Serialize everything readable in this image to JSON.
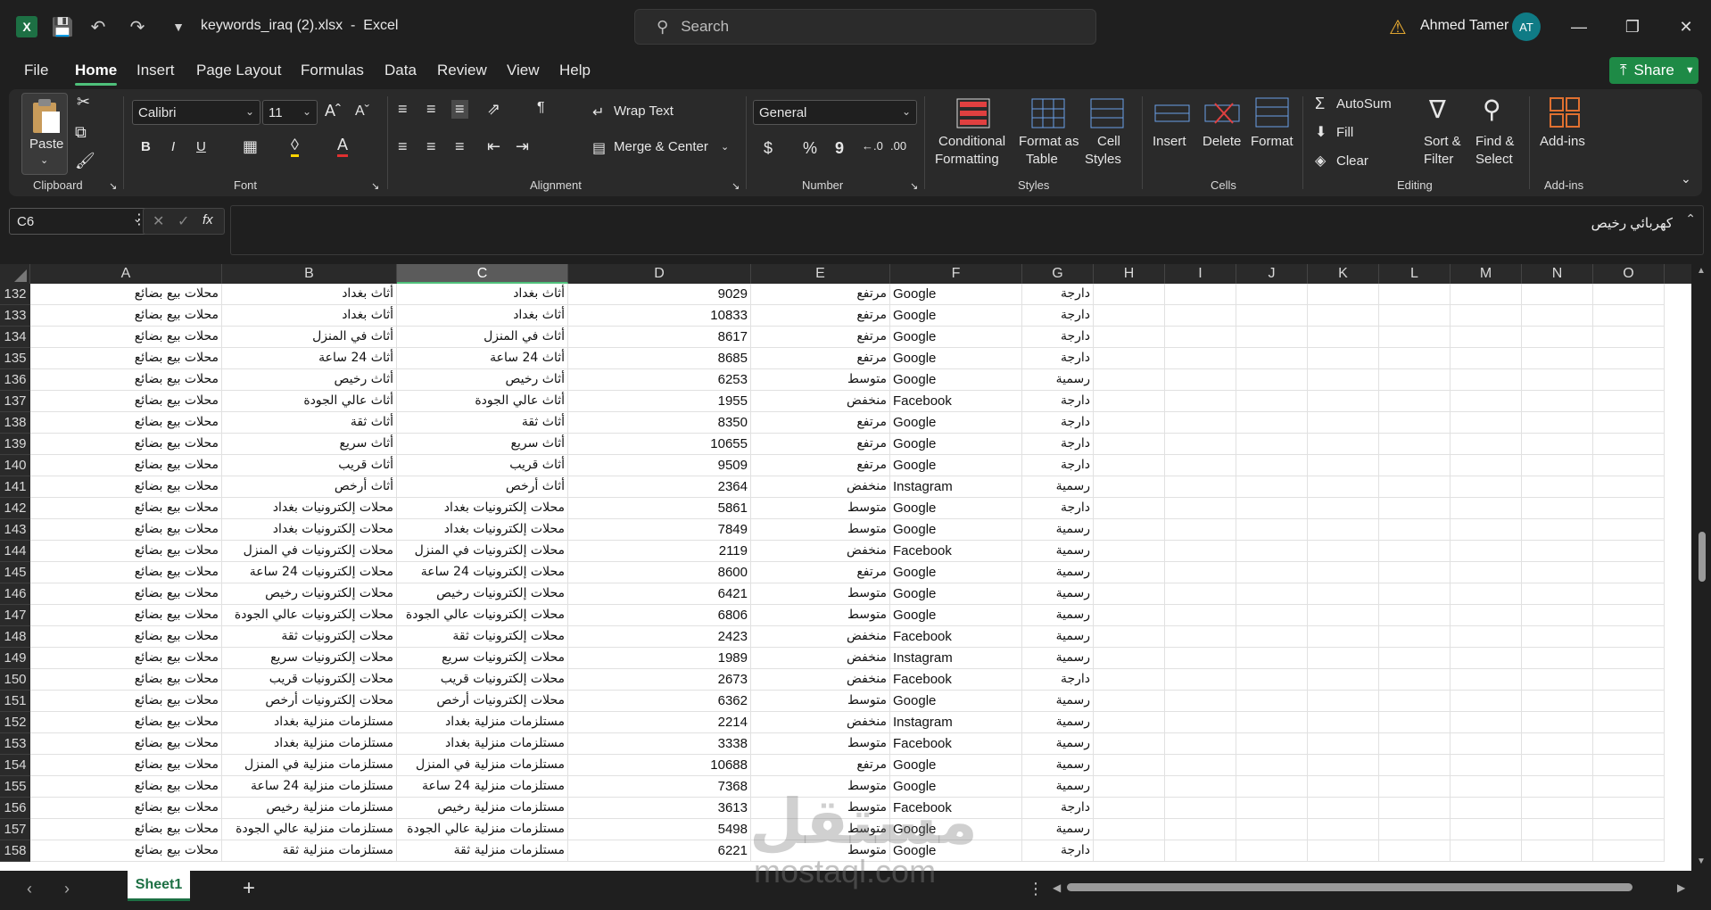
{
  "titlebar": {
    "file_name": "keywords_iraq (2).xlsx",
    "app_sep": "-",
    "app_name": "Excel",
    "search_placeholder": "Search",
    "user_name": "Ahmed Tamer",
    "user_initials": "AT"
  },
  "menu": [
    "File",
    "Home",
    "Insert",
    "Page Layout",
    "Formulas",
    "Data",
    "Review",
    "View",
    "Help"
  ],
  "share_label": "Share",
  "ribbon": {
    "clipboard": {
      "paste": "Paste",
      "label": "Clipboard"
    },
    "font": {
      "family": "Calibri",
      "size": "11",
      "label": "Font",
      "bold": "B",
      "italic": "I",
      "underline": "U"
    },
    "alignment": {
      "wrap": "Wrap Text",
      "merge": "Merge & Center",
      "label": "Alignment"
    },
    "number": {
      "format": "General",
      "label": "Number",
      "currency": "$",
      "percent": "%",
      "comma": "9"
    },
    "styles": {
      "conditional_1": "Conditional",
      "conditional_2": "Formatting",
      "table_1": "Format as",
      "table_2": "Table",
      "cell_1": "Cell",
      "cell_2": "Styles",
      "label": "Styles"
    },
    "cells": {
      "insert": "Insert",
      "delete": "Delete",
      "format": "Format",
      "label": "Cells"
    },
    "editing": {
      "autosum": "AutoSum",
      "fill": "Fill",
      "clear": "Clear",
      "sort_1": "Sort &",
      "sort_2": "Filter",
      "find_1": "Find &",
      "find_2": "Select",
      "label": "Editing"
    },
    "addins": {
      "name": "Add-ins",
      "label": "Add-ins"
    }
  },
  "formula_bar": {
    "cell_ref": "C6",
    "fx": "fx",
    "content": "كهربائي رخيص"
  },
  "columns": [
    "A",
    "B",
    "C",
    "D",
    "E",
    "F",
    "G",
    "H",
    "I",
    "J",
    "K",
    "L",
    "M",
    "N",
    "O"
  ],
  "rows": [
    {
      "n": "132",
      "a": "محلات بيع بضائع",
      "b": "أثاث بغداد",
      "c": "أثاث بغداد",
      "d": "9029",
      "e": "مرتفع",
      "f": "Google",
      "g": "دارجة"
    },
    {
      "n": "133",
      "a": "محلات بيع بضائع",
      "b": "أثاث بغداد",
      "c": "أثاث بغداد",
      "d": "10833",
      "e": "مرتفع",
      "f": "Google",
      "g": "دارجة"
    },
    {
      "n": "134",
      "a": "محلات بيع بضائع",
      "b": "أثاث في المنزل",
      "c": "أثاث في المنزل",
      "d": "8617",
      "e": "مرتفع",
      "f": "Google",
      "g": "دارجة"
    },
    {
      "n": "135",
      "a": "محلات بيع بضائع",
      "b": "أثاث 24 ساعة",
      "c": "أثاث 24 ساعة",
      "d": "8685",
      "e": "مرتفع",
      "f": "Google",
      "g": "دارجة"
    },
    {
      "n": "136",
      "a": "محلات بيع بضائع",
      "b": "أثاث رخيص",
      "c": "أثاث رخيص",
      "d": "6253",
      "e": "متوسط",
      "f": "Google",
      "g": "رسمية"
    },
    {
      "n": "137",
      "a": "محلات بيع بضائع",
      "b": "أثاث عالي الجودة",
      "c": "أثاث عالي الجودة",
      "d": "1955",
      "e": "منخفض",
      "f": "Facebook",
      "g": "دارجة"
    },
    {
      "n": "138",
      "a": "محلات بيع بضائع",
      "b": "أثاث ثقة",
      "c": "أثاث ثقة",
      "d": "8350",
      "e": "مرتفع",
      "f": "Google",
      "g": "دارجة"
    },
    {
      "n": "139",
      "a": "محلات بيع بضائع",
      "b": "أثاث سريع",
      "c": "أثاث سريع",
      "d": "10655",
      "e": "مرتفع",
      "f": "Google",
      "g": "دارجة"
    },
    {
      "n": "140",
      "a": "محلات بيع بضائع",
      "b": "أثاث قريب",
      "c": "أثاث قريب",
      "d": "9509",
      "e": "مرتفع",
      "f": "Google",
      "g": "دارجة"
    },
    {
      "n": "141",
      "a": "محلات بيع بضائع",
      "b": "أثاث أرخص",
      "c": "أثاث أرخص",
      "d": "2364",
      "e": "منخفض",
      "f": "Instagram",
      "g": "رسمية"
    },
    {
      "n": "142",
      "a": "محلات بيع بضائع",
      "b": "محلات إلكترونيات بغداد",
      "c": "محلات إلكترونيات بغداد",
      "d": "5861",
      "e": "متوسط",
      "f": "Google",
      "g": "دارجة"
    },
    {
      "n": "143",
      "a": "محلات بيع بضائع",
      "b": "محلات إلكترونيات بغداد",
      "c": "محلات إلكترونيات بغداد",
      "d": "7849",
      "e": "متوسط",
      "f": "Google",
      "g": "رسمية"
    },
    {
      "n": "144",
      "a": "محلات بيع بضائع",
      "b": "محلات إلكترونيات في المنزل",
      "c": "محلات إلكترونيات في المنزل",
      "d": "2119",
      "e": "منخفض",
      "f": "Facebook",
      "g": "رسمية"
    },
    {
      "n": "145",
      "a": "محلات بيع بضائع",
      "b": "محلات إلكترونيات 24 ساعة",
      "c": "محلات إلكترونيات 24 ساعة",
      "d": "8600",
      "e": "مرتفع",
      "f": "Google",
      "g": "رسمية"
    },
    {
      "n": "146",
      "a": "محلات بيع بضائع",
      "b": "محلات إلكترونيات رخيص",
      "c": "محلات إلكترونيات رخيص",
      "d": "6421",
      "e": "متوسط",
      "f": "Google",
      "g": "رسمية"
    },
    {
      "n": "147",
      "a": "محلات بيع بضائع",
      "b": "محلات إلكترونيات عالي الجودة",
      "c": "محلات إلكترونيات عالي الجودة",
      "d": "6806",
      "e": "متوسط",
      "f": "Google",
      "g": "رسمية"
    },
    {
      "n": "148",
      "a": "محلات بيع بضائع",
      "b": "محلات إلكترونيات ثقة",
      "c": "محلات إلكترونيات ثقة",
      "d": "2423",
      "e": "منخفض",
      "f": "Facebook",
      "g": "رسمية"
    },
    {
      "n": "149",
      "a": "محلات بيع بضائع",
      "b": "محلات إلكترونيات سريع",
      "c": "محلات إلكترونيات سريع",
      "d": "1989",
      "e": "منخفض",
      "f": "Instagram",
      "g": "رسمية"
    },
    {
      "n": "150",
      "a": "محلات بيع بضائع",
      "b": "محلات إلكترونيات قريب",
      "c": "محلات إلكترونيات قريب",
      "d": "2673",
      "e": "منخفض",
      "f": "Facebook",
      "g": "دارجة"
    },
    {
      "n": "151",
      "a": "محلات بيع بضائع",
      "b": "محلات إلكترونيات أرخص",
      "c": "محلات إلكترونيات أرخص",
      "d": "6362",
      "e": "متوسط",
      "f": "Google",
      "g": "رسمية"
    },
    {
      "n": "152",
      "a": "محلات بيع بضائع",
      "b": "مستلزمات منزلية بغداد",
      "c": "مستلزمات منزلية بغداد",
      "d": "2214",
      "e": "منخفض",
      "f": "Instagram",
      "g": "رسمية"
    },
    {
      "n": "153",
      "a": "محلات بيع بضائع",
      "b": "مستلزمات منزلية بغداد",
      "c": "مستلزمات منزلية بغداد",
      "d": "3338",
      "e": "متوسط",
      "f": "Facebook",
      "g": "رسمية"
    },
    {
      "n": "154",
      "a": "محلات بيع بضائع",
      "b": "مستلزمات منزلية في المنزل",
      "c": "مستلزمات منزلية في المنزل",
      "d": "10688",
      "e": "مرتفع",
      "f": "Google",
      "g": "رسمية"
    },
    {
      "n": "155",
      "a": "محلات بيع بضائع",
      "b": "مستلزمات منزلية 24 ساعة",
      "c": "مستلزمات منزلية 24 ساعة",
      "d": "7368",
      "e": "متوسط",
      "f": "Google",
      "g": "رسمية"
    },
    {
      "n": "156",
      "a": "محلات بيع بضائع",
      "b": "مستلزمات منزلية رخيص",
      "c": "مستلزمات منزلية رخيص",
      "d": "3613",
      "e": "متوسط",
      "f": "Facebook",
      "g": "دارجة"
    },
    {
      "n": "157",
      "a": "محلات بيع بضائع",
      "b": "مستلزمات منزلية عالي الجودة",
      "c": "مستلزمات منزلية عالي الجودة",
      "d": "5498",
      "e": "متوسط",
      "f": "Google",
      "g": "رسمية"
    },
    {
      "n": "158",
      "a": "محلات بيع بضائع",
      "b": "مستلزمات منزلية ثقة",
      "c": "مستلزمات منزلية ثقة",
      "d": "6221",
      "e": "متوسط",
      "f": "Google",
      "g": "دارجة"
    }
  ],
  "sheet_tab": "Sheet1",
  "watermark": {
    "arabic": "مستقل",
    "latin": "mostaql.com"
  },
  "colors": {
    "accent": "#4ec07a",
    "excel_green": "#1d7044",
    "share": "#1e8a46"
  }
}
